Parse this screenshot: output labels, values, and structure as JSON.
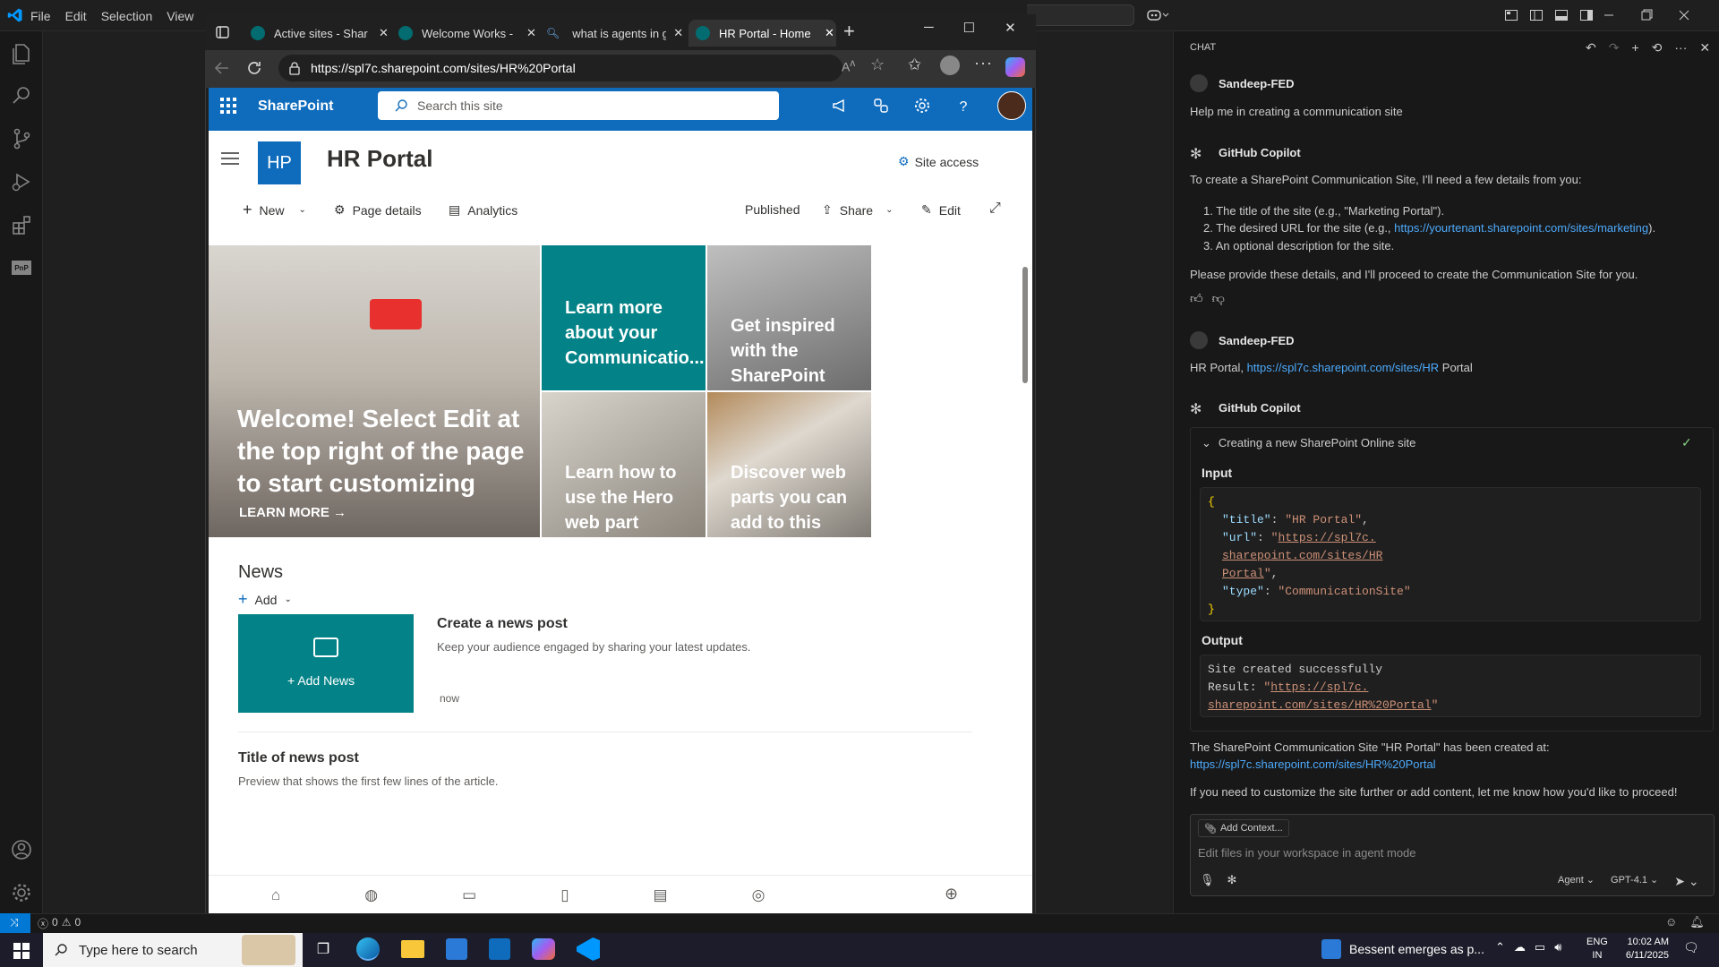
{
  "vscode": {
    "menu": [
      "File",
      "Edit",
      "Selection",
      "View"
    ],
    "status": {
      "errors": "0",
      "warnings": "0"
    }
  },
  "browser": {
    "tabs": [
      {
        "label": "Active sites - ShareP"
      },
      {
        "label": "Welcome Works - C"
      },
      {
        "label": "what is agents in git"
      },
      {
        "label": "HR Portal - Home"
      }
    ],
    "url": "https://spl7c.sharepoint.com/sites/HR%20Portal"
  },
  "sharepoint": {
    "brand": "SharePoint",
    "search_placeholder": "Search this site",
    "site_logo": "HP",
    "site_title": "HR Portal",
    "site_access": "Site access",
    "commandbar": {
      "new": "New",
      "page_details": "Page details",
      "analytics": "Analytics",
      "published": "Published",
      "share": "Share",
      "edit": "Edit"
    },
    "hero": {
      "main_text": "Welcome! Select Edit at the top right of the page to start customizing",
      "learn_more": "LEARN MORE",
      "tiles": [
        "Learn more about your Communicatio...",
        "Get inspired with the SharePoint look book",
        "Learn how to use the Hero web part",
        "Discover web parts you can add to this page"
      ]
    },
    "news": {
      "heading": "News",
      "add": "Add",
      "add_news": "Add News",
      "create_title": "Create a news post",
      "create_desc": "Keep your audience engaged by sharing your latest updates.",
      "time": "now",
      "post_title": "Title of news post",
      "post_desc": "Preview that shows the first few lines of the article."
    }
  },
  "chat": {
    "header": "CHAT",
    "messages": {
      "user1_name": "Sandeep-FED",
      "user1_text": "Help me in creating a communication site",
      "bot1_name": "GitHub Copilot",
      "bot1_intro": "To create a SharePoint Communication Site, I'll need a few details from you:",
      "bot1_item1": "1. The title of the site (e.g., \"Marketing Portal\").",
      "bot1_item2_prefix": "2. The desired URL for the site (e.g., ",
      "bot1_item2_link": "https://yourtenant.sharepoint.com/sites/marketing",
      "bot1_item2_suffix": ").",
      "bot1_item3": "3. An optional description for the site.",
      "bot1_outro": "Please provide these details, and I'll proceed to create the Communication Site for you.",
      "user2_name": "Sandeep-FED",
      "user2_prefix": "HR Portal, ",
      "user2_link": "https://spl7c.sharepoint.com/sites/HR",
      "user2_suffix": " Portal",
      "bot2_name": "GitHub Copilot",
      "tool_title": "Creating a new SharePoint Online site",
      "input_label": "Input",
      "output_label": "Output",
      "input_title_key": "\"title\"",
      "input_title_val": "\"HR Portal\"",
      "input_url_key": "\"url\"",
      "input_url_val_1": "https://spl7c.",
      "input_url_val_2": "sharepoint.com/sites/HR",
      "input_url_val_3": "Portal",
      "input_type_key": "\"type\"",
      "input_type_val": "\"CommunicationSite\"",
      "output_line1": "Site created successfully",
      "output_line2_prefix": "Result: ",
      "output_line2_val": "https://spl7c.",
      "output_line3_val": "sharepoint.com/sites/HR%20Portal",
      "bot2_created": "The SharePoint Communication Site \"HR Portal\" has been created at:",
      "bot2_link": "https://spl7c.sharepoint.com/sites/HR%20Portal",
      "bot2_outro": "If you need to customize the site further or add content, let me know how you'd like to proceed!"
    },
    "input": {
      "add_context": "Add Context...",
      "placeholder": "Edit files in your workspace in agent mode",
      "mode": "Agent",
      "model": "GPT-4.1"
    }
  },
  "taskbar": {
    "search": "Type here to search",
    "news": "Bessent emerges as p...",
    "lang1": "ENG",
    "lang2": "IN",
    "time": "10:02 AM",
    "date": "6/11/2025"
  }
}
